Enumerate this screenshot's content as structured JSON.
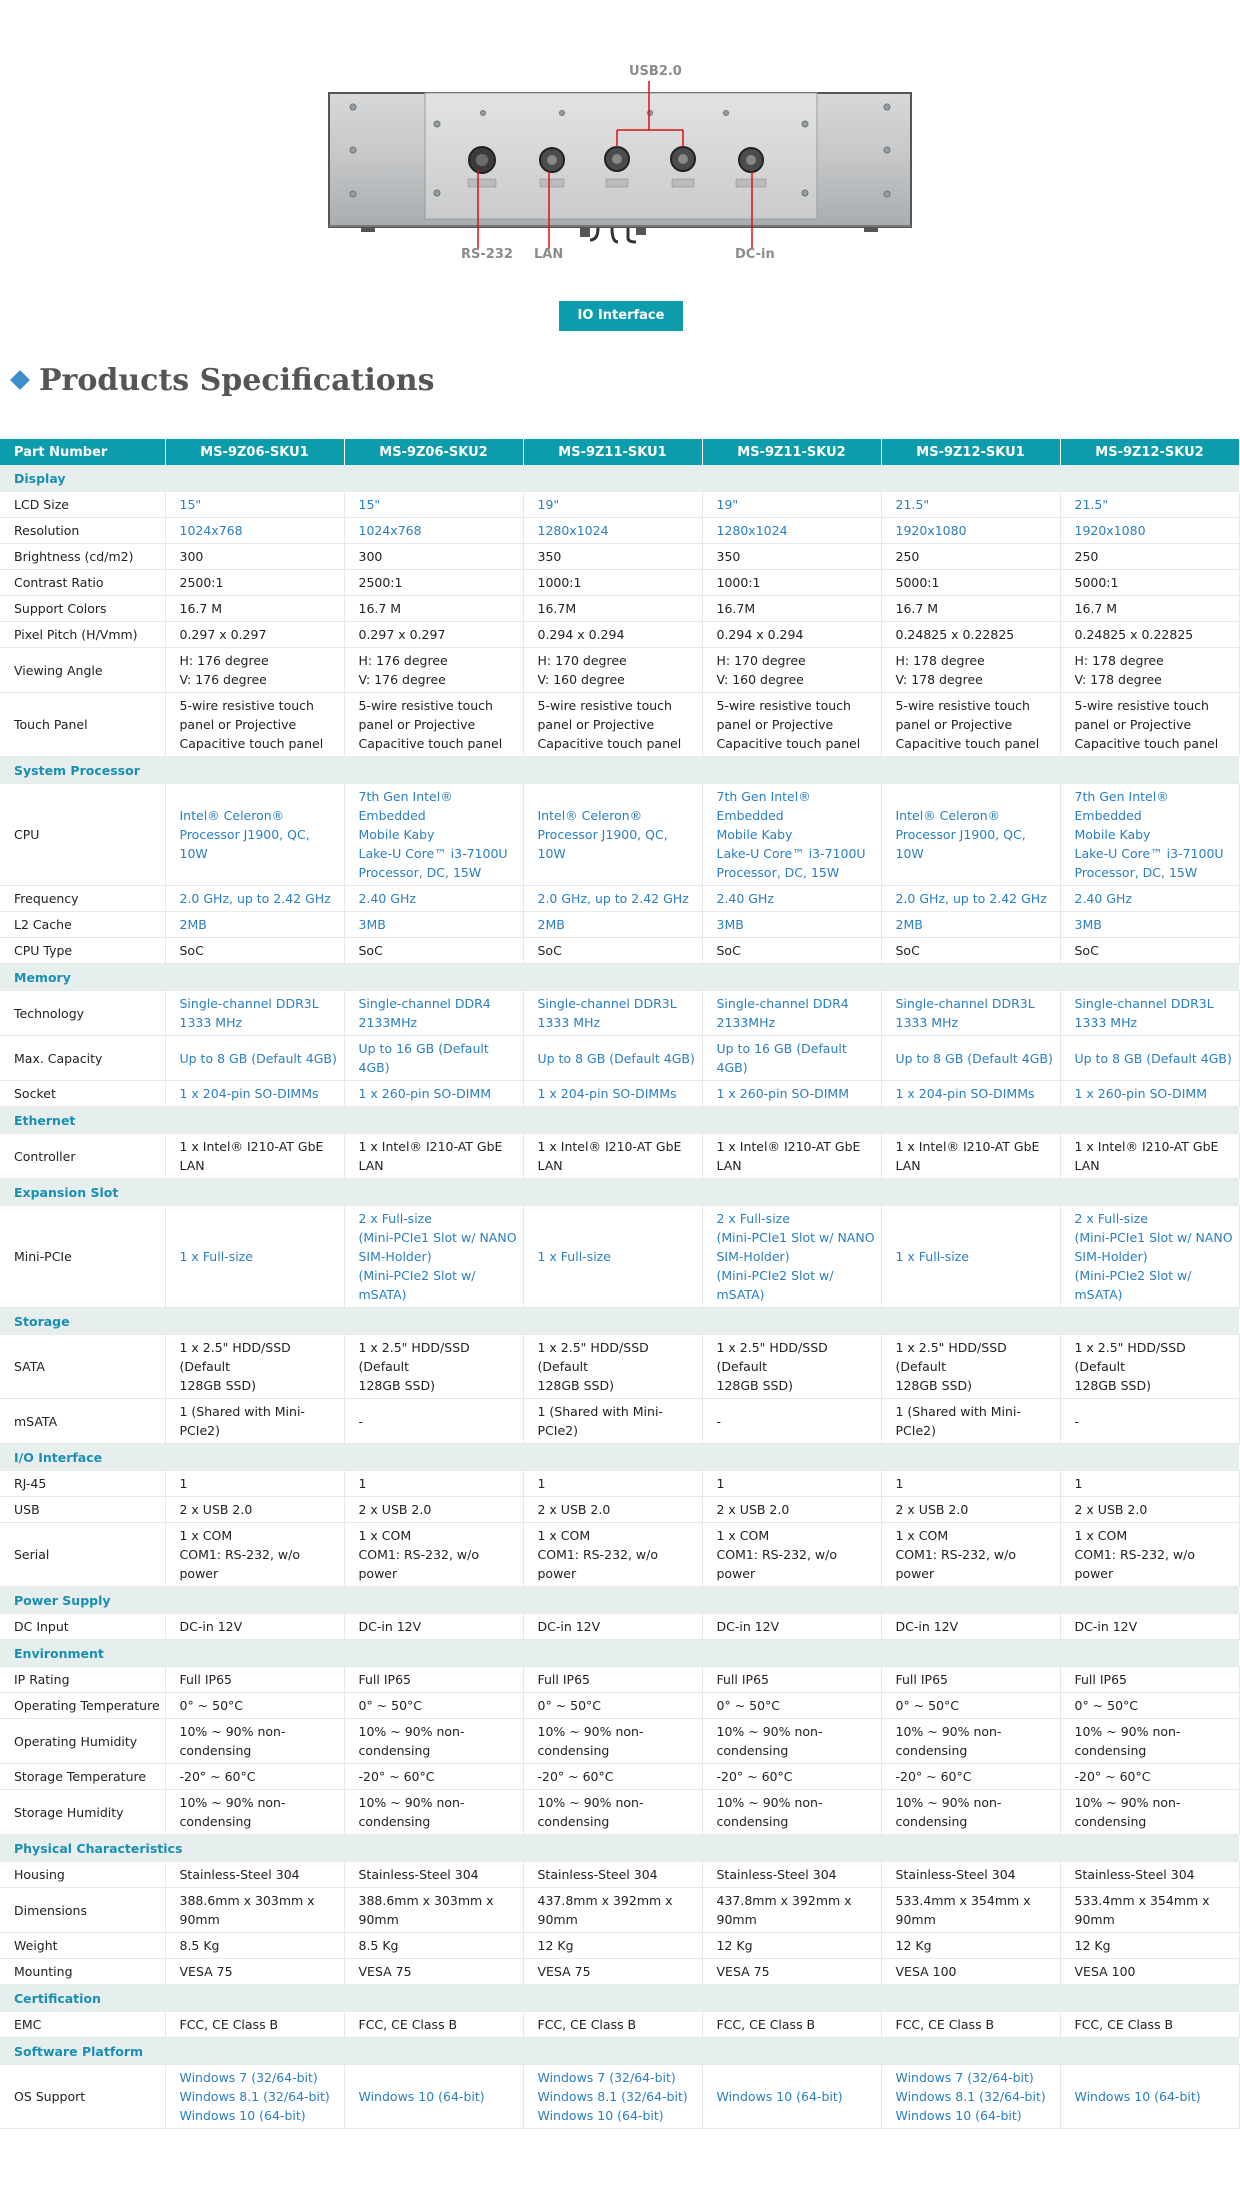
{
  "io": {
    "labels": {
      "usb": "USB2.0",
      "rs232": "RS-232",
      "lan": "LAN",
      "dcin": "DC-in"
    },
    "port_marks": [
      "RS-232",
      "LAN",
      "USB",
      "USB",
      "DC-IN"
    ],
    "button_label": "IO Interface"
  },
  "heading": "Products Specifications",
  "colors": {
    "accent": "#0c9cac",
    "section_bg": "#e6eeee",
    "section_text": "#1a8fb3",
    "link_blue": "#2a7fc1"
  },
  "table": {
    "header": [
      "Part Number",
      "MS-9Z06-SKU1",
      "MS-9Z06-SKU2",
      "MS-9Z11-SKU1",
      "MS-9Z11-SKU2",
      "MS-9Z12-SKU1",
      "MS-9Z12-SKU2"
    ],
    "rows": [
      {
        "section": "Display"
      },
      {
        "label": "LCD Size",
        "blue": true,
        "values": [
          "15\"",
          "15\"",
          "19\"",
          "19\"",
          "21.5\"",
          "21.5\""
        ]
      },
      {
        "label": "Resolution",
        "blue": true,
        "values": [
          "1024x768",
          "1024x768",
          "1280x1024",
          "1280x1024",
          "1920x1080",
          "1920x1080"
        ]
      },
      {
        "label": "Brightness (cd/m2)",
        "values": [
          "300",
          "300",
          "350",
          "350",
          "250",
          "250"
        ]
      },
      {
        "label": "Contrast Ratio",
        "values": [
          "2500:1",
          "2500:1",
          "1000:1",
          "1000:1",
          "5000:1",
          "5000:1"
        ]
      },
      {
        "label": "Support Colors",
        "values": [
          "16.7 M",
          "16.7 M",
          "16.7M",
          "16.7M",
          "16.7 M",
          "16.7 M"
        ]
      },
      {
        "label": "Pixel Pitch (H/Vmm)",
        "values": [
          "0.297 x 0.297",
          "0.297 x 0.297",
          "0.294 x 0.294",
          "0.294 x 0.294",
          "0.24825 x 0.22825",
          "0.24825 x 0.22825"
        ]
      },
      {
        "label": "Viewing Angle",
        "values": [
          "H: 176 degree\nV: 176 degree",
          "H: 176 degree\nV: 176 degree",
          "H: 170 degree\nV: 160 degree",
          "H: 170 degree\nV: 160 degree",
          "H: 178 degree\nV: 178 degree",
          "H: 178 degree\nV: 178 degree"
        ]
      },
      {
        "label": "Touch Panel",
        "values": [
          "5-wire resistive touch\npanel or Projective\nCapacitive touch panel",
          "5-wire resistive touch\npanel or Projective\nCapacitive touch panel",
          "5-wire resistive touch\npanel or Projective\nCapacitive touch panel",
          "5-wire resistive touch\npanel or Projective\nCapacitive touch panel",
          "5-wire resistive touch\npanel or Projective\nCapacitive touch panel",
          "5-wire resistive touch\npanel or Projective\nCapacitive touch panel"
        ]
      },
      {
        "section": "System Processor"
      },
      {
        "label": "CPU",
        "blue": true,
        "values": [
          "Intel® Celeron®\nProcessor J1900, QC, 10W",
          "7th Gen Intel® Embedded\nMobile Kaby\nLake-U Core™ i3-7100U\nProcessor, DC, 15W",
          "Intel® Celeron®\nProcessor J1900, QC, 10W",
          "7th Gen Intel® Embedded\nMobile Kaby\nLake-U Core™ i3-7100U\nProcessor, DC, 15W",
          "Intel® Celeron®\nProcessor J1900, QC, 10W",
          "7th Gen Intel® Embedded\nMobile Kaby\nLake-U Core™ i3-7100U\nProcessor, DC, 15W"
        ]
      },
      {
        "label": "Frequency",
        "blue": true,
        "values": [
          "2.0 GHz, up to 2.42 GHz",
          "2.40 GHz",
          "2.0 GHz, up to 2.42 GHz",
          "2.40 GHz",
          "2.0 GHz, up to 2.42 GHz",
          "2.40 GHz"
        ]
      },
      {
        "label": "L2 Cache",
        "blue": true,
        "values": [
          "2MB",
          "3MB",
          "2MB",
          "3MB",
          "2MB",
          "3MB"
        ]
      },
      {
        "label": "CPU Type",
        "values": [
          "SoC",
          "SoC",
          "SoC",
          "SoC",
          "SoC",
          "SoC"
        ]
      },
      {
        "section": "Memory"
      },
      {
        "label": "Technology",
        "blue": true,
        "values": [
          "Single-channel DDR3L\n1333 MHz",
          "Single-channel DDR4\n2133MHz",
          "Single-channel DDR3L\n1333 MHz",
          "Single-channel DDR4\n2133MHz",
          "Single-channel DDR3L\n1333 MHz",
          "Single-channel DDR3L\n1333 MHz"
        ]
      },
      {
        "label": "Max. Capacity",
        "blue": true,
        "values": [
          "Up to 8 GB (Default 4GB)",
          "Up to 16 GB (Default 4GB)",
          "Up to 8 GB (Default 4GB)",
          "Up to 16 GB (Default 4GB)",
          "Up to 8 GB (Default 4GB)",
          "Up to 8 GB (Default 4GB)"
        ]
      },
      {
        "label": "Socket",
        "blue": true,
        "values": [
          "1 x 204-pin SO-DIMMs",
          "1 x 260-pin SO-DIMM",
          "1 x 204-pin SO-DIMMs",
          "1 x 260-pin SO-DIMM",
          "1 x 204-pin SO-DIMMs",
          "1 x 260-pin SO-DIMM"
        ]
      },
      {
        "section": "Ethernet"
      },
      {
        "label": "Controller",
        "values": [
          "1 x Intel® I210-AT GbE\nLAN",
          "1 x Intel® I210-AT GbE\nLAN",
          "1 x Intel® I210-AT GbE\nLAN",
          "1 x Intel® I210-AT GbE\nLAN",
          "1 x Intel® I210-AT GbE\nLAN",
          "1 x Intel® I210-AT GbE\nLAN"
        ]
      },
      {
        "section": "Expansion Slot"
      },
      {
        "label": "Mini-PCIe",
        "blue": true,
        "tall": true,
        "values": [
          "1 x Full-size",
          "2 x Full-size\n(Mini-PCIe1 Slot w/ NANO\nSIM-Holder)\n(Mini-PCIe2 Slot w/\nmSATA)",
          "1 x Full-size",
          "2 x Full-size\n(Mini-PCIe1 Slot w/ NANO\nSIM-Holder)\n(Mini-PCIe2 Slot w/\nmSATA)",
          "1 x Full-size",
          "2 x Full-size\n(Mini-PCIe1 Slot w/ NANO\nSIM-Holder)\n(Mini-PCIe2 Slot w/\nmSATA)"
        ]
      },
      {
        "section": "Storage"
      },
      {
        "label": "SATA",
        "values": [
          "1 x 2.5\" HDD/SSD (Default\n128GB SSD)",
          "1 x 2.5\" HDD/SSD (Default\n128GB SSD)",
          "1 x 2.5\" HDD/SSD (Default\n128GB SSD)",
          "1 x 2.5\" HDD/SSD (Default\n128GB SSD)",
          "1 x 2.5\" HDD/SSD (Default\n128GB SSD)",
          "1 x 2.5\" HDD/SSD (Default\n128GB SSD)"
        ]
      },
      {
        "label": "mSATA",
        "values": [
          "1 (Shared with Mini-PCIe2)",
          "-",
          "1 (Shared with Mini-PCIe2)",
          "-",
          "1 (Shared with Mini-PCIe2)",
          "-"
        ]
      },
      {
        "section": "I/O Interface"
      },
      {
        "label": "RJ-45",
        "values": [
          "1",
          "1",
          "1",
          "1",
          "1",
          "1"
        ]
      },
      {
        "label": "USB",
        "values": [
          "2 x USB 2.0",
          "2 x USB 2.0",
          "2 x USB 2.0",
          "2 x USB 2.0",
          "2 x USB 2.0",
          "2 x USB 2.0"
        ]
      },
      {
        "label": "Serial",
        "values": [
          "1 x COM\nCOM1: RS-232, w/o power",
          "1 x COM\nCOM1: RS-232, w/o power",
          "1 x COM\nCOM1: RS-232, w/o power",
          "1 x COM\nCOM1: RS-232, w/o power",
          "1 x COM\nCOM1: RS-232, w/o power",
          "1 x COM\nCOM1: RS-232, w/o power"
        ]
      },
      {
        "section": "Power Supply"
      },
      {
        "label": "DC Input",
        "values": [
          "DC-in 12V",
          "DC-in 12V",
          "DC-in 12V",
          "DC-in 12V",
          "DC-in 12V",
          "DC-in 12V"
        ]
      },
      {
        "section": "Environment"
      },
      {
        "label": "IP Rating",
        "values": [
          "Full IP65",
          "Full IP65",
          "Full IP65",
          "Full IP65",
          "Full IP65",
          "Full IP65"
        ]
      },
      {
        "label": "Operating Temperature",
        "values": [
          "0° ~ 50°C",
          "0° ~ 50°C",
          "0° ~ 50°C",
          "0° ~ 50°C",
          "0° ~ 50°C",
          "0° ~ 50°C"
        ]
      },
      {
        "label": "Operating Humidity",
        "values": [
          "10% ~ 90% non-\ncondensing",
          "10% ~ 90% non-\ncondensing",
          "10% ~ 90% non-\ncondensing",
          "10% ~ 90% non-\ncondensing",
          "10% ~ 90% non-\ncondensing",
          "10% ~ 90% non-\ncondensing"
        ]
      },
      {
        "label": "Storage Temperature",
        "values": [
          "-20° ~ 60°C",
          "-20° ~ 60°C",
          "-20° ~ 60°C",
          "-20° ~ 60°C",
          "-20° ~ 60°C",
          "-20° ~ 60°C"
        ]
      },
      {
        "label": "Storage Humidity",
        "values": [
          "10% ~ 90% non-\ncondensing",
          "10% ~ 90% non-\ncondensing",
          "10% ~ 90% non-\ncondensing",
          "10% ~ 90% non-\ncondensing",
          "10% ~ 90% non-\ncondensing",
          "10% ~ 90% non-\ncondensing"
        ]
      },
      {
        "section": "Physical Characteristics"
      },
      {
        "label": "Housing",
        "values": [
          "Stainless-Steel 304",
          "Stainless-Steel 304",
          "Stainless-Steel 304",
          "Stainless-Steel 304",
          "Stainless-Steel 304",
          "Stainless-Steel 304"
        ]
      },
      {
        "label": "Dimensions",
        "values": [
          "388.6mm x 303mm x\n90mm",
          "388.6mm x 303mm x\n90mm",
          "437.8mm x 392mm x\n90mm",
          "437.8mm x 392mm x\n90mm",
          "533.4mm x 354mm x\n90mm",
          "533.4mm x 354mm x\n90mm"
        ]
      },
      {
        "label": "Weight",
        "values": [
          "8.5 Kg",
          "8.5 Kg",
          "12 Kg",
          "12 Kg",
          "12 Kg",
          "12 Kg"
        ]
      },
      {
        "label": "Mounting",
        "values": [
          "VESA 75",
          "VESA 75",
          "VESA 75",
          "VESA 75",
          "VESA 100",
          "VESA 100"
        ]
      },
      {
        "section": "Certification"
      },
      {
        "label": "EMC",
        "values": [
          "FCC, CE Class B",
          "FCC, CE Class B",
          "FCC, CE Class B",
          "FCC, CE Class B",
          "FCC, CE Class B",
          "FCC, CE Class B"
        ]
      },
      {
        "section": "Software Platform"
      },
      {
        "label": "OS Support",
        "blue": true,
        "values": [
          "Windows 7 (32/64-bit)\nWindows 8.1 (32/64-bit)\nWindows 10 (64-bit)",
          "Windows 10 (64-bit)",
          "Windows 7 (32/64-bit)\nWindows 8.1 (32/64-bit)\nWindows 10 (64-bit)",
          "Windows 10 (64-bit)",
          "Windows 7 (32/64-bit)\nWindows 8.1 (32/64-bit)\nWindows 10 (64-bit)",
          "Windows 10 (64-bit)"
        ]
      }
    ]
  }
}
